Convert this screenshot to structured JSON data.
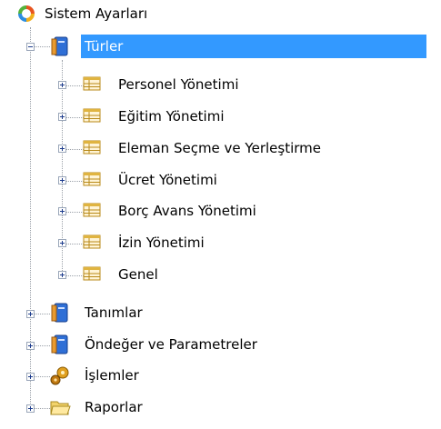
{
  "tree": {
    "root": {
      "label": "Sistem Ayarları",
      "icon": "system-settings-icon"
    },
    "nodes": [
      {
        "label": "Türler",
        "icon": "blue-book-icon",
        "expanded": true,
        "selected": true,
        "children": [
          {
            "label": "Personel Yönetimi",
            "icon": "table-icon"
          },
          {
            "label": "Eğitim Yönetimi",
            "icon": "table-icon"
          },
          {
            "label": "Eleman Seçme ve Yerleştirme",
            "icon": "table-icon"
          },
          {
            "label": "Ücret Yönetimi",
            "icon": "table-icon"
          },
          {
            "label": "Borç Avans Yönetimi",
            "icon": "table-icon"
          },
          {
            "label": "İzin Yönetimi",
            "icon": "table-icon"
          },
          {
            "label": "Genel",
            "icon": "table-icon"
          }
        ]
      },
      {
        "label": "Tanımlar",
        "icon": "blue-book-icon"
      },
      {
        "label": "Öndeğer ve Parametreler",
        "icon": "blue-book-icon"
      },
      {
        "label": "İşlemler",
        "icon": "gears-icon"
      },
      {
        "label": "Raporlar",
        "icon": "folder-icon"
      }
    ]
  }
}
